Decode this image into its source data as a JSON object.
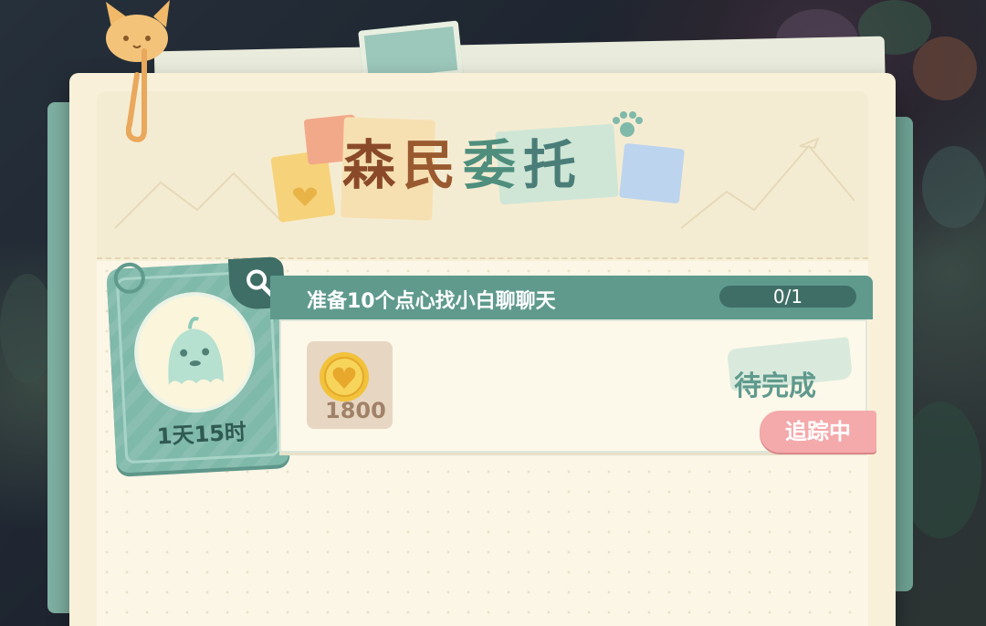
{
  "window": {
    "title": "森民委托"
  },
  "header": {
    "title_chars": [
      "森",
      "民",
      "委",
      "托"
    ]
  },
  "npc_card": {
    "timer": "1天15时",
    "icon": "ghost-spirit-icon",
    "corner_icon": "magnifier-icon"
  },
  "task": {
    "title": "准备10个点心找小白聊聊天",
    "progress": "0/1",
    "reward": {
      "icon": "heart-coin-icon",
      "amount": "1800"
    },
    "status": "待完成",
    "tracking_label": "追踪中"
  },
  "colors": {
    "panel_paper": "#f8f0d8",
    "teal_accent": "#5f9a8d",
    "tracking_pink": "#f4a9aa",
    "title_brown": "#8a4a2a",
    "title_green": "#4f8e7d"
  }
}
